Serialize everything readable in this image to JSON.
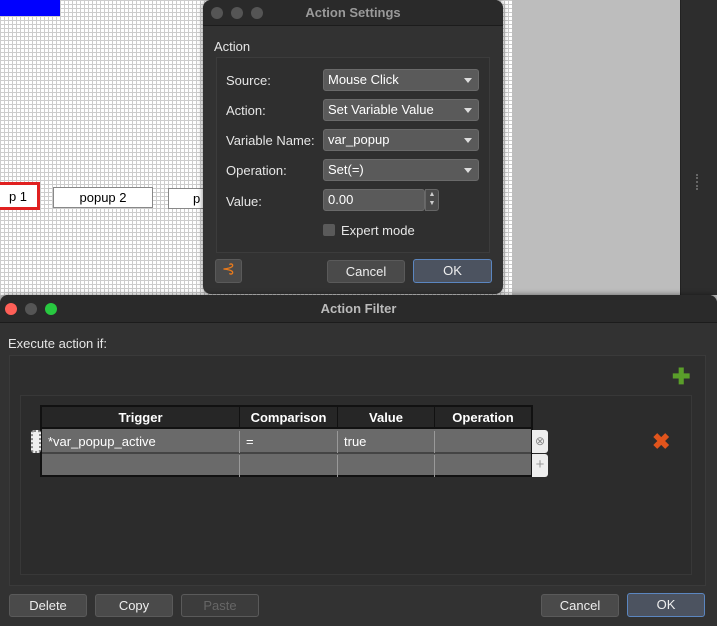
{
  "background": {
    "buttons": [
      "p 1",
      "popup 2",
      "p"
    ]
  },
  "action_settings": {
    "title": "Action Settings",
    "group_label": "Action",
    "rows": [
      {
        "label": "Source:",
        "value": "Mouse Click"
      },
      {
        "label": "Action:",
        "value": "Set Variable Value"
      },
      {
        "label": "Variable Name:",
        "value": "var_popup"
      },
      {
        "label": "Operation:",
        "value": "Set(=)"
      }
    ],
    "value_label": "Value:",
    "value": "0.00",
    "expert_mode_label": "Expert mode",
    "expert_mode_checked": false,
    "cancel": "Cancel",
    "ok": "OK"
  },
  "action_filter": {
    "title": "Action Filter",
    "execute_label": "Execute action if:",
    "columns": [
      "Trigger",
      "Comparison",
      "Value",
      "Operation"
    ],
    "rows": [
      [
        "*var_popup_active",
        "=",
        "true",
        ""
      ],
      [
        "",
        "",
        "",
        ""
      ]
    ],
    "delete": "Delete",
    "copy": "Copy",
    "paste": "Paste",
    "cancel": "Cancel",
    "ok": "OK"
  },
  "colors": {
    "accent_blue": "#0000ff",
    "selection_red": "#e02020",
    "add_green": "#5a9e2a",
    "remove_orange": "#e0541c"
  }
}
